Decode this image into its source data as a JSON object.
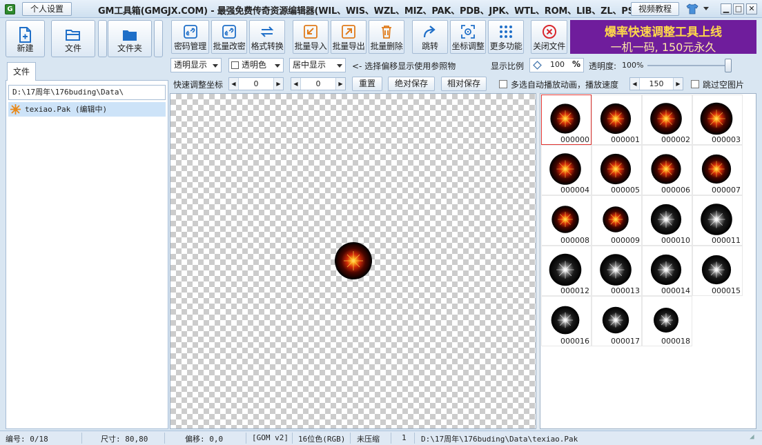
{
  "titlebar": {
    "app_icon": "G",
    "personal_settings": "个人设置",
    "title": "GM工具箱(GMGJX.COM) - 最强免费传奇资源编辑器(WIL、WIS、WZL、MIZ、PAK、PDB、JPK、WTL、ROM、LIB、ZL、PSK)",
    "video_tutorial": "视频教程",
    "icons": [
      "shirt-icon",
      "chevron-down-icon",
      "minimize-icon",
      "maximize-icon",
      "close-icon"
    ]
  },
  "left_toolbar": {
    "new": "新建",
    "file": "文件",
    "folder": "文件夹"
  },
  "toolbar": [
    {
      "label": "密码管理",
      "icon": "link-icon"
    },
    {
      "label": "批量改密",
      "icon": "link-icon"
    },
    {
      "label": "格式转换",
      "icon": "swap-icon"
    },
    {
      "label": "批量导入",
      "icon": "import-icon"
    },
    {
      "label": "批量导出",
      "icon": "export-icon"
    },
    {
      "label": "批量删除",
      "icon": "trash-icon"
    },
    {
      "label": "跳转",
      "icon": "redo-arrow-icon"
    },
    {
      "label": "坐标调整",
      "icon": "target-icon"
    },
    {
      "label": "更多功能",
      "icon": "grid-dots-icon"
    },
    {
      "label": "关闭文件",
      "icon": "close-circle-icon"
    }
  ],
  "ad": {
    "line1": "爆率快速调整工具上线",
    "line2": "一机一码, 150元永久",
    "bg_color": "#6f1d9c"
  },
  "left_panel": {
    "tab": "文件",
    "path": "D:\\17周年\\176buding\\Data\\",
    "file_item": "texiao.Pak (编辑中)"
  },
  "options": {
    "display_mode": "透明显示",
    "transparent_color": "透明色",
    "alignment": "居中显示",
    "hint": "<- 选择偏移显示使用参照物",
    "scale_label": "显示比例",
    "scale_value": "100",
    "scale_unit": "%",
    "opacity_label": "透明度:",
    "opacity_value": "100%",
    "opacity_level": 1.0
  },
  "options2": {
    "quick_adjust": "快速调整坐标",
    "x_value": "0",
    "y_value": "0",
    "reset": "重置",
    "absolute_save": "绝对保存",
    "relative_save": "相对保存",
    "auto_play": "多选自动播放动画，播放速度",
    "speed": "150",
    "skip_empty": "跳过空图片"
  },
  "thumbnails": [
    {
      "label": "000000",
      "kind": "red",
      "size": 0.9,
      "selected": true
    },
    {
      "label": "000001",
      "kind": "red",
      "size": 0.92
    },
    {
      "label": "000002",
      "kind": "red",
      "size": 0.95
    },
    {
      "label": "000003",
      "kind": "red",
      "size": 0.97
    },
    {
      "label": "000004",
      "kind": "red",
      "size": 0.95
    },
    {
      "label": "000005",
      "kind": "red",
      "size": 0.92
    },
    {
      "label": "000006",
      "kind": "red",
      "size": 0.9
    },
    {
      "label": "000007",
      "kind": "red",
      "size": 0.88
    },
    {
      "label": "000008",
      "kind": "red",
      "size": 0.82
    },
    {
      "label": "000009",
      "kind": "red",
      "size": 0.78
    },
    {
      "label": "000010",
      "kind": "white",
      "size": 0.92
    },
    {
      "label": "000011",
      "kind": "white",
      "size": 0.95
    },
    {
      "label": "000012",
      "kind": "white",
      "size": 0.97
    },
    {
      "label": "000013",
      "kind": "white",
      "size": 0.95
    },
    {
      "label": "000014",
      "kind": "white",
      "size": 0.92
    },
    {
      "label": "000015",
      "kind": "white",
      "size": 0.88
    },
    {
      "label": "000016",
      "kind": "white",
      "size": 0.85
    },
    {
      "label": "000017",
      "kind": "white",
      "size": 0.8
    },
    {
      "label": "000018",
      "kind": "white",
      "size": 0.75
    }
  ],
  "statusbar": {
    "index": "编号: 0/18",
    "size": "尺寸: 80,80",
    "offset": "偏移: 0,0",
    "format": "[GOM v2]",
    "color_depth": "16位色(RGB)",
    "compression": "未压缩",
    "count": "1",
    "path": "D:\\17周年\\176buding\\Data\\texiao.Pak"
  }
}
